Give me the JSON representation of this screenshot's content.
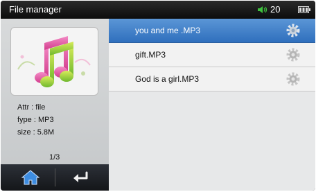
{
  "status_bar": {
    "app_title": "File manager",
    "volume": "20"
  },
  "file_info": {
    "attr": "Attr : file",
    "type": "fype : MP3",
    "size": "size : 5.8M",
    "page": "1/3"
  },
  "files": [
    {
      "name": "you and me .MP3",
      "selected": true
    },
    {
      "name": "gift.MP3",
      "selected": false
    },
    {
      "name": "God is a girl.MP3",
      "selected": false
    }
  ],
  "icons": {
    "thumbnail": "music-notes-icon",
    "home": "home-icon",
    "back": "back-arrow-icon",
    "settings": "gear-icon",
    "volume": "speaker-icon",
    "battery": "battery-icon"
  },
  "colors": {
    "selected_row": "#3f7fc8",
    "status_bar": "#111111",
    "panel": "#cfd1d3"
  }
}
